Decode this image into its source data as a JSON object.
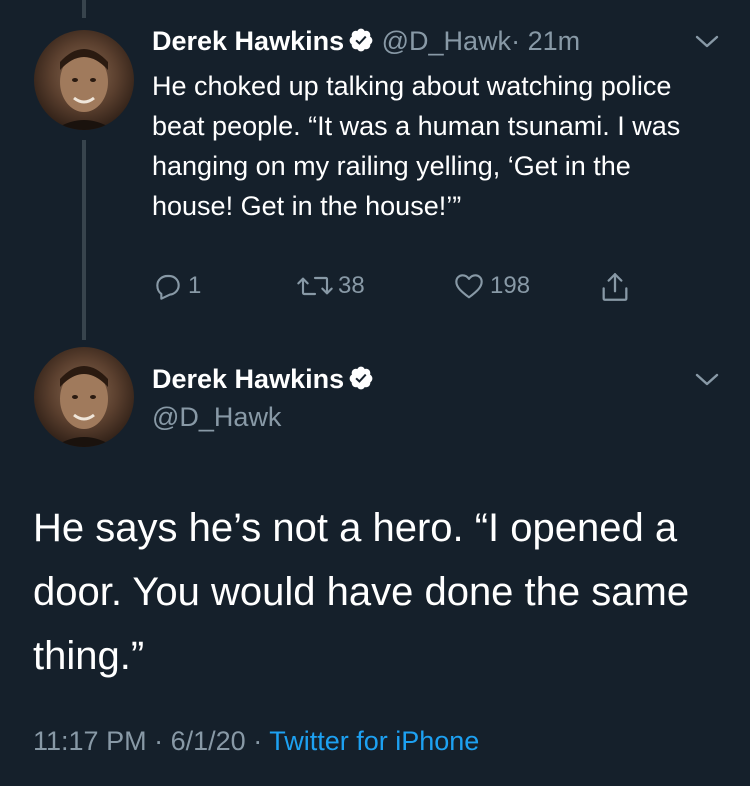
{
  "colors": {
    "background": "#15202b",
    "text_primary": "#ffffff",
    "text_secondary": "#8899a6",
    "link": "#1da1f2",
    "verified": "#ffffff"
  },
  "tweet1": {
    "author_name": "Derek Hawkins",
    "handle": "@D_Hawk",
    "separator": "·",
    "time_ago": "21m",
    "text": "He choked up talking about watching police beat people. “It was a human tsunami. I was hanging on my railing yelling, ‘Get in the house! Get in the house!’”",
    "replies": "1",
    "retweets": "38",
    "likes": "198",
    "icons": {
      "reply": "reply-icon",
      "retweet": "retweet-icon",
      "like": "heart-icon",
      "share": "share-icon",
      "menu": "chevron-down-icon",
      "verified": "verified-badge-icon"
    }
  },
  "tweet2": {
    "author_name": "Derek Hawkins",
    "handle": "@D_Hawk",
    "text": "He says he’s not a hero. “I opened a door. You would have done the same thing.”",
    "time": "11:17 PM",
    "separator1": "·",
    "date": "6/1/20",
    "separator2": "·",
    "source": "Twitter for iPhone"
  }
}
